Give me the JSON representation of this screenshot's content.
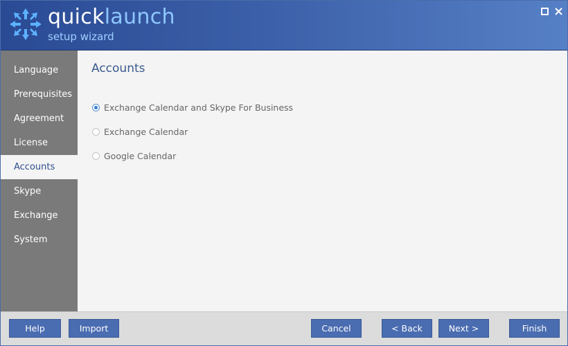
{
  "header": {
    "title_part1": "quick",
    "title_part2": "launch",
    "subtitle": "setup wizard",
    "logo_icon": "arrows-burst-icon",
    "controls": [
      {
        "icon": "maximize-icon"
      },
      {
        "icon": "close-icon"
      }
    ]
  },
  "sidebar": {
    "items": [
      {
        "label": "Language"
      },
      {
        "label": "Prerequisites"
      },
      {
        "label": "Agreement"
      },
      {
        "label": "License"
      },
      {
        "label": "Accounts",
        "active": true
      },
      {
        "label": "Skype"
      },
      {
        "label": "Exchange"
      },
      {
        "label": "System"
      }
    ]
  },
  "main": {
    "title": "Accounts",
    "options": [
      {
        "label": "Exchange Calendar and Skype For Business",
        "checked": true
      },
      {
        "label": "Exchange Calendar",
        "checked": false
      },
      {
        "label": "Google Calendar",
        "checked": false
      }
    ]
  },
  "footer": {
    "help": "Help",
    "import": "Import",
    "cancel": "Cancel",
    "back": "< Back",
    "next": "Next >",
    "finish": "Finish"
  },
  "colors": {
    "header_start": "#2a4a94",
    "header_end": "#5680c6",
    "sidebar_bg": "#7a7a7a",
    "accent_text": "#3a5a8c",
    "button_bg": "#4a6cb0",
    "radio_dot": "#2f7de1"
  }
}
